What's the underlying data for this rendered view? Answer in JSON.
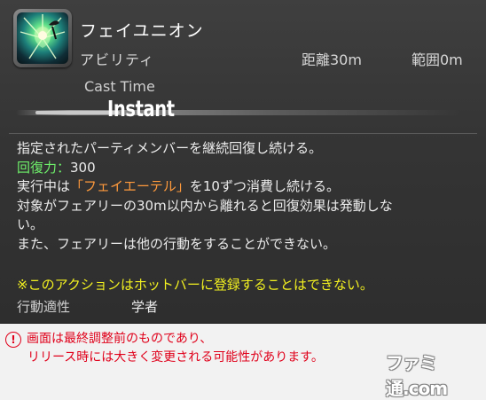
{
  "action": {
    "name": "フェイユニオン",
    "type": "アビリティ",
    "range": "距離30m",
    "radius": "範囲0m",
    "cast_time_label": "Cast Time",
    "cast_time_value": "Instant",
    "icon": "fairy-union-icon"
  },
  "description": {
    "line1": "指定されたパーティメンバーを継続回復し続ける。",
    "potency_label": "回復力：",
    "potency_value": "300",
    "line3_pre": "実行中は",
    "line3_highlight": "「フェイエーテル」",
    "line3_post": "を10ずつ消費し続ける。",
    "line4": "対象がフェアリーの30m以内から離れると回復効果は発動しな",
    "line5": "い。",
    "line6": "また、フェアリーは他の行動をすることができない。",
    "note": "※このアクションはホットバーに登録することはできない。",
    "job_label": "行動適性",
    "job_value": "学者"
  },
  "caption": {
    "line1": "画面は最終調整前のものであり、",
    "line2": "リリース時には大きく変更される可能性があります。",
    "warning_icon_glyph": "!"
  },
  "watermark": "ファミ通.com",
  "colors": {
    "potency": "#6ef06a",
    "highlight": "#ff9a3c",
    "note": "#f2f020",
    "caption": "#e0001a"
  }
}
